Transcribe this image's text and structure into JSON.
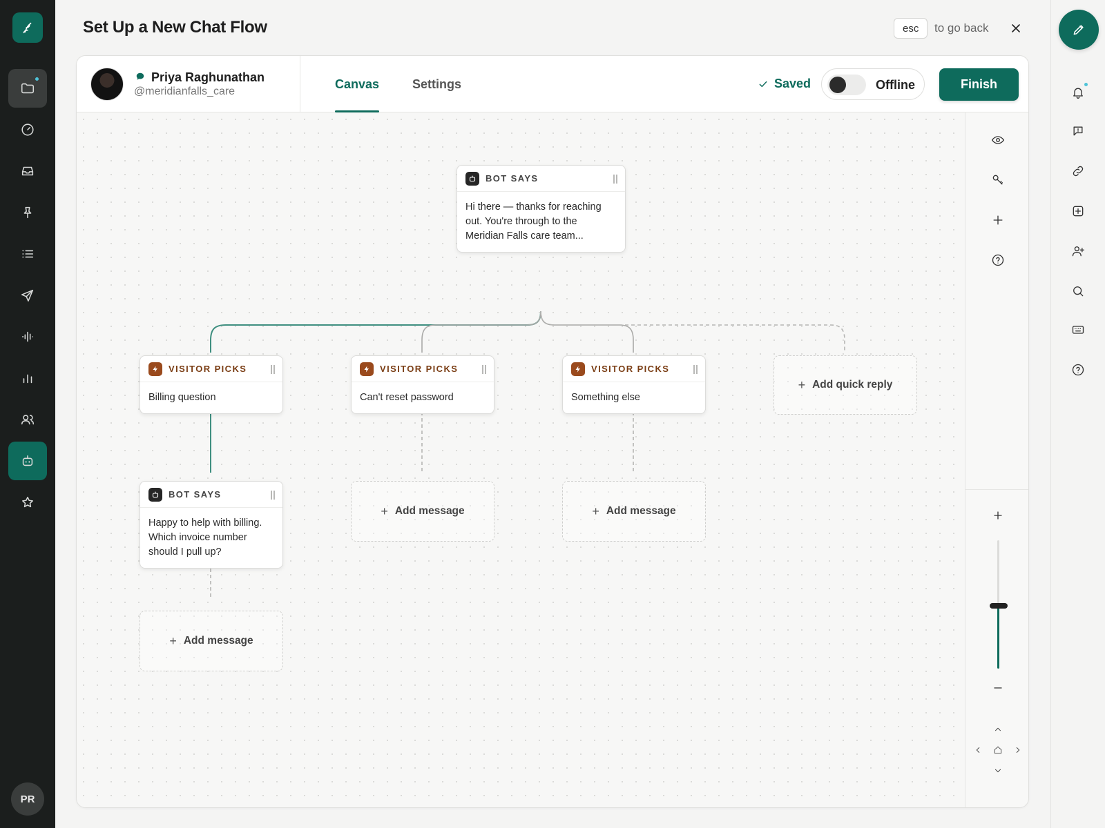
{
  "header": {
    "title": "Set Up a New Chat Flow",
    "esc_key": "esc",
    "esc_hint": "to go back"
  },
  "user": {
    "name": "Priya Raghunathan",
    "handle": "@meridianfalls_care",
    "initials": "PR"
  },
  "tabs": [
    {
      "label": "Canvas",
      "active": true
    },
    {
      "label": "Settings",
      "active": false
    }
  ],
  "status": {
    "saved_label": "Saved",
    "presence_label": "Offline",
    "presence_on": false
  },
  "actions": {
    "finish_label": "Finish"
  },
  "flow": {
    "root": {
      "type_label": "BOT SAYS",
      "text": "Hi there — thanks for reaching out. You're through to the Meridian Falls care team..."
    },
    "replies": [
      {
        "type_label": "VISITOR PICKS",
        "text": "Billing question"
      },
      {
        "type_label": "VISITOR PICKS",
        "text": "Can't reset password"
      },
      {
        "type_label": "VISITOR PICKS",
        "text": "Something else"
      }
    ],
    "add_quick_reply_label": "Add quick reply",
    "billing_followup": {
      "type_label": "BOT SAYS",
      "text": "Happy to help with billing. Which invoice number should I pull up?"
    },
    "add_message_label": "Add message"
  },
  "zoom": {
    "level_fraction": 0.49
  },
  "colors": {
    "brand": "#0e6b5c",
    "visitor_accent": "#9a4a1d",
    "sidebar_bg": "#1b1e1d"
  },
  "icons": {
    "leftbar": [
      "folder-icon",
      "gauge-icon",
      "inbox-icon",
      "pin-icon",
      "list-icon",
      "send-icon",
      "waveform-icon",
      "bar-chart-icon",
      "users-icon",
      "bot-icon",
      "star-icon"
    ],
    "rightrail": [
      "bell-icon",
      "message-icon",
      "link-icon",
      "plus-square-icon",
      "user-plus-icon",
      "search-icon",
      "keyboard-icon",
      "help-icon"
    ],
    "canvas_tools": [
      "eye-icon",
      "key-icon",
      "plus-icon",
      "help-icon"
    ]
  }
}
